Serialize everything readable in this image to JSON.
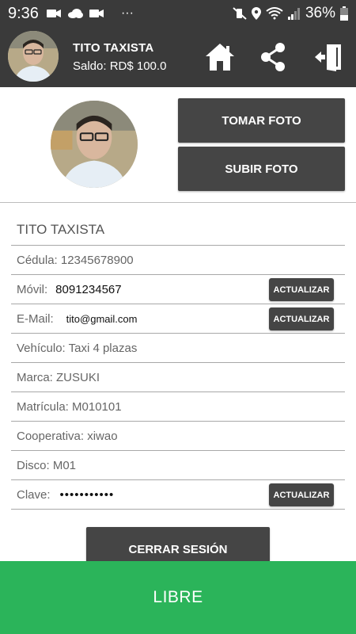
{
  "status_bar": {
    "time": "9:36",
    "dots": "···",
    "battery": "36%"
  },
  "header": {
    "user_name": "TITO TAXISTA",
    "saldo": "Saldo: RD$ 100.0",
    "icons": [
      "home-icon",
      "share-icon",
      "exit-door-icon"
    ]
  },
  "photo": {
    "take_label": "TOMAR FOTO",
    "upload_label": "SUBIR FOTO"
  },
  "profile": {
    "name": "TITO TAXISTA",
    "cedula": "Cédula: 12345678900",
    "movil_label": "Móvil:",
    "movil_value": "8091234567",
    "email_label": "E-Mail:",
    "email_value": "tito@gmail.com",
    "vehiculo": "Vehículo: Taxi 4 plazas",
    "marca": "Marca: ZUSUKI",
    "matricula": "Matrícula: M010101",
    "cooperativa": "Cooperativa: xiwao",
    "disco": "Disco: M01",
    "clave_label": "Clave:",
    "clave_value": "•••••••••••",
    "update_label": "ACTUALIZAR"
  },
  "logout_label": "CERRAR SESIÓN",
  "status_label": "LIBRE",
  "colors": {
    "header_bg": "#3a3a3a",
    "button_bg": "#454545",
    "status_green": "#2bb45a"
  }
}
